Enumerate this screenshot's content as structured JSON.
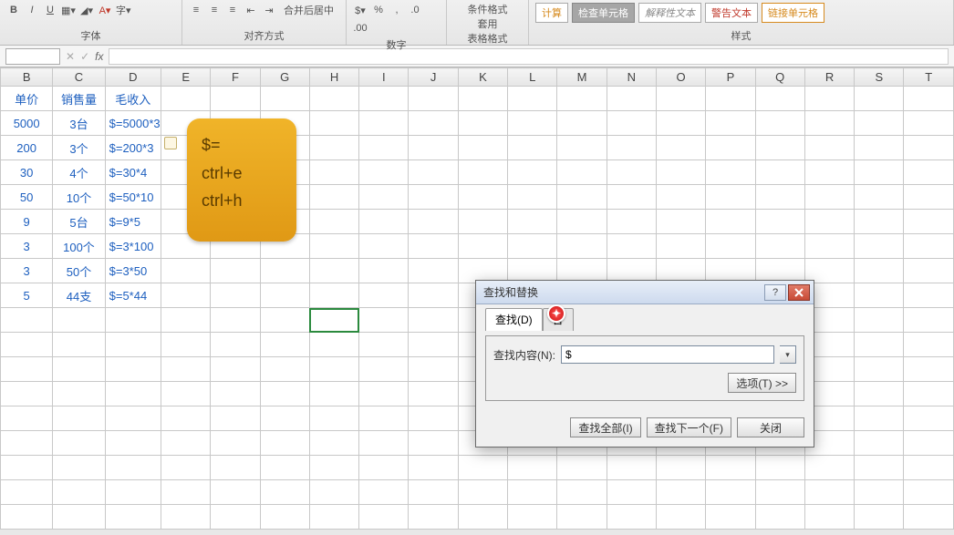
{
  "ribbon": {
    "groups": {
      "font": {
        "label": "字体"
      },
      "align": {
        "label": "对齐方式",
        "merge_label": "合并后居中"
      },
      "number": {
        "label": "数字"
      },
      "cond": {
        "label1": "条件格式",
        "label2": "套用\n表格格式"
      },
      "styles": {
        "label": "样式",
        "swatches": [
          {
            "text": "计算",
            "bg": "#fff",
            "fg": "#d68a1e",
            "border": "#aaa"
          },
          {
            "text": "检查单元格",
            "bg": "#a6a6a6",
            "fg": "#fff",
            "border": "#888"
          },
          {
            "text": "解释性文本",
            "bg": "#fff",
            "fg": "#888",
            "border": "#aaa",
            "italic": true
          },
          {
            "text": "警告文本",
            "bg": "#fff",
            "fg": "#c0392b",
            "border": "#aaa"
          },
          {
            "text": "链接单元格",
            "bg": "#fff",
            "fg": "#d68a1e",
            "border": "#d68a1e"
          }
        ]
      }
    }
  },
  "columns": [
    "B",
    "C",
    "D",
    "E",
    "F",
    "G",
    "H",
    "I",
    "J",
    "K",
    "L",
    "M",
    "N",
    "O",
    "P",
    "Q",
    "R",
    "S",
    "T"
  ],
  "headers": [
    "单价",
    "销售量",
    "毛收入"
  ],
  "rows": [
    [
      "5000",
      "3台",
      "$=5000*3"
    ],
    [
      "200",
      "3个",
      "$=200*3"
    ],
    [
      "30",
      "4个",
      "$=30*4"
    ],
    [
      "50",
      "10个",
      "$=50*10"
    ],
    [
      "9",
      "5台",
      "$=9*5"
    ],
    [
      "3",
      "100个",
      "$=3*100"
    ],
    [
      "3",
      "50个",
      "$=3*50"
    ],
    [
      "5",
      "44支",
      "$=5*44"
    ]
  ],
  "note": {
    "l1": "$=",
    "l2": "ctrl+e",
    "l3": "ctrl+h"
  },
  "dialog": {
    "title": "查找和替换",
    "tab_find": "查找(D)",
    "tab_replace": "替",
    "find_label": "查找内容(N):",
    "find_value": "$",
    "options": "选项(T) >>",
    "find_all": "查找全部(I)",
    "find_next": "查找下一个(F)",
    "close": "关闭"
  }
}
